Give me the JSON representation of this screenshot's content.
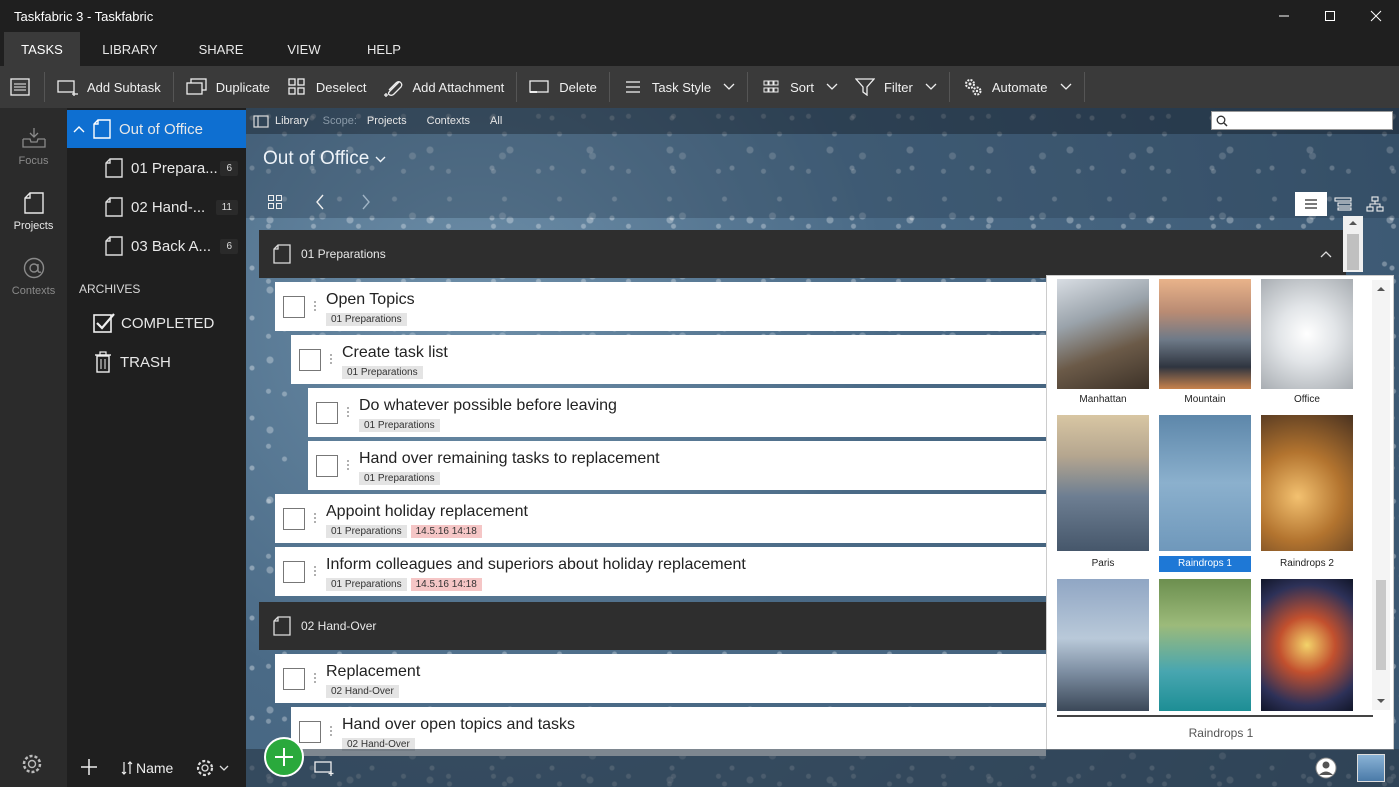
{
  "window": {
    "title": "Taskfabric 3 - Taskfabric"
  },
  "menu": {
    "tabs": [
      "TASKS",
      "LIBRARY",
      "SHARE",
      "VIEW",
      "HELP"
    ]
  },
  "toolbar": {
    "add_subtask": "Add Subtask",
    "duplicate": "Duplicate",
    "deselect": "Deselect",
    "add_attachment": "Add Attachment",
    "delete": "Delete",
    "task_style": "Task Style",
    "sort": "Sort",
    "filter": "Filter",
    "automate": "Automate"
  },
  "rail": {
    "focus": "Focus",
    "projects": "Projects",
    "contexts": "Contexts"
  },
  "projects": {
    "root": "Out of Office",
    "items": [
      {
        "name": "01 Prepara...",
        "count": "6"
      },
      {
        "name": "02 Hand-...",
        "count": "11"
      },
      {
        "name": "03 Back A...",
        "count": "6"
      }
    ],
    "archives_label": "ARCHIVES",
    "completed": "COMPLETED",
    "trash": "TRASH",
    "sort_label": "Name"
  },
  "breadcrumb": {
    "library": "Library",
    "scope": "Scope:",
    "projects": "Projects",
    "contexts": "Contexts",
    "all": "All"
  },
  "search": {
    "placeholder": ""
  },
  "header": {
    "title": "Out of Office"
  },
  "groups": [
    {
      "title": "01 Preparations"
    },
    {
      "title": "02 Hand-Over"
    }
  ],
  "tasks": [
    {
      "title": "Open Topics",
      "tag": "01 Preparations",
      "date": ""
    },
    {
      "title": "Create task list",
      "tag": "01 Preparations",
      "date": ""
    },
    {
      "title": "Do whatever possible before leaving",
      "tag": "01 Preparations",
      "date": ""
    },
    {
      "title": "Hand over remaining tasks to replacement",
      "tag": "01 Preparations",
      "date": ""
    },
    {
      "title": "Appoint holiday replacement",
      "tag": "01 Preparations",
      "date": "14.5.16 14:18"
    },
    {
      "title": "Inform colleagues and superiors about holiday replacement",
      "tag": "01 Preparations",
      "date": "14.5.16 14:18"
    },
    {
      "title": "Replacement",
      "tag": "02 Hand-Over",
      "date": ""
    },
    {
      "title": "Hand over open topics and tasks",
      "tag": "02 Hand-Over",
      "date": ""
    }
  ],
  "picker": {
    "items": [
      {
        "label": "Manhattan"
      },
      {
        "label": "Mountain"
      },
      {
        "label": "Office"
      },
      {
        "label": "Paris"
      },
      {
        "label": "Raindrops 1"
      },
      {
        "label": "Raindrops 2"
      },
      {
        "label": ""
      },
      {
        "label": ""
      },
      {
        "label": ""
      }
    ],
    "selected_label": "Raindrops 1"
  },
  "colors": {
    "accent": "#0e6fd1",
    "fab": "#2aa93c",
    "date_tag": "#f5c6c6"
  }
}
